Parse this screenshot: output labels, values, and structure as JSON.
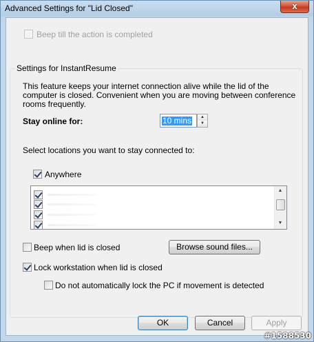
{
  "window": {
    "title": "Advanced Settings for \"Lid Closed\"",
    "close_symbol": "x"
  },
  "beep_action": {
    "label": "Beep till the action is completed",
    "checked": false,
    "enabled": false
  },
  "instant_resume": {
    "group_title": "Settings for InstantResume",
    "description": "This feature keeps your internet connection alive while the lid of the computer is closed. Convenient when you are moving between conference rooms frequently.",
    "stay_online_label": "Stay online for:",
    "stay_online_value": "10 mins",
    "locations_label": "Select locations you want to stay connected to:",
    "anywhere_label": "Anywhere",
    "anywhere_checked": true,
    "location_rows": 4,
    "beep_lid_label": "Beep when lid is closed",
    "beep_lid_checked": false,
    "browse_button": "Browse sound files...",
    "lock_label": "Lock workstation when lid is closed",
    "lock_checked": true,
    "no_auto_lock_label": "Do not automatically lock the PC if movement is detected",
    "no_auto_lock_checked": false
  },
  "buttons": {
    "ok": "OK",
    "cancel": "Cancel",
    "apply": "Apply"
  },
  "icons": {
    "spin_up": "spin-up-icon",
    "spin_down": "spin-down-icon",
    "scroll_up": "scroll-up-icon",
    "scroll_down": "scroll-down-icon"
  },
  "watermark": "#1588530"
}
